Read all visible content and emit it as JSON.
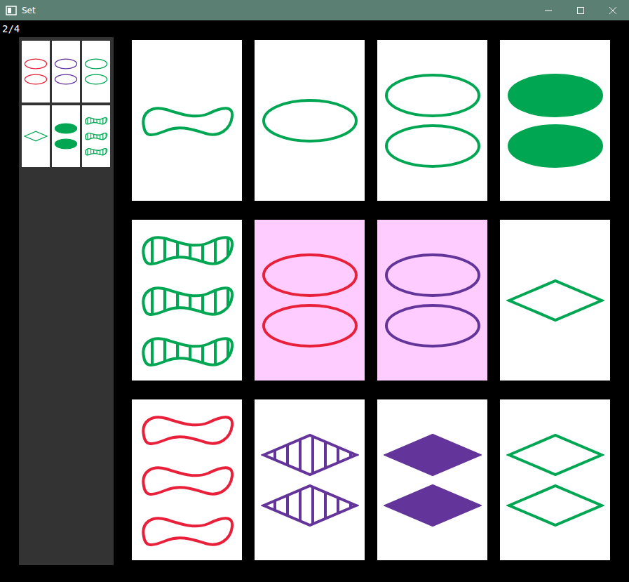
{
  "window": {
    "title": "Set"
  },
  "counter": "2/4",
  "found_sets": [
    [
      {
        "count": 2,
        "kind": "oval",
        "fill": "empty",
        "color": "#e8203a"
      },
      {
        "count": 2,
        "kind": "oval",
        "fill": "empty",
        "color": "#63359a"
      },
      {
        "count": 2,
        "kind": "oval",
        "fill": "empty",
        "color": "#00a651"
      }
    ],
    [
      {
        "count": 1,
        "kind": "diamond",
        "fill": "empty",
        "color": "#00a651"
      },
      {
        "count": 2,
        "kind": "oval",
        "fill": "solid",
        "color": "#00a651"
      },
      {
        "count": 3,
        "kind": "squiggle",
        "fill": "striped",
        "color": "#00a651"
      }
    ]
  ],
  "board": [
    {
      "count": 1,
      "kind": "squiggle",
      "fill": "empty",
      "color": "#00a651",
      "selected": false
    },
    {
      "count": 1,
      "kind": "oval",
      "fill": "empty",
      "color": "#00a651",
      "selected": false
    },
    {
      "count": 2,
      "kind": "oval",
      "fill": "empty",
      "color": "#00a651",
      "selected": false
    },
    {
      "count": 2,
      "kind": "oval",
      "fill": "solid",
      "color": "#00a651",
      "selected": false
    },
    {
      "count": 3,
      "kind": "squiggle",
      "fill": "striped",
      "color": "#00a651",
      "selected": false
    },
    {
      "count": 2,
      "kind": "oval",
      "fill": "empty",
      "color": "#e8203a",
      "selected": true
    },
    {
      "count": 2,
      "kind": "oval",
      "fill": "empty",
      "color": "#63359a",
      "selected": true
    },
    {
      "count": 1,
      "kind": "diamond",
      "fill": "empty",
      "color": "#00a651",
      "selected": false
    },
    {
      "count": 3,
      "kind": "squiggle",
      "fill": "empty",
      "color": "#e8203a",
      "selected": false
    },
    {
      "count": 2,
      "kind": "diamond",
      "fill": "striped",
      "color": "#63359a",
      "selected": false
    },
    {
      "count": 2,
      "kind": "diamond",
      "fill": "solid",
      "color": "#63359a",
      "selected": false
    },
    {
      "count": 2,
      "kind": "diamond",
      "fill": "empty",
      "color": "#00a651",
      "selected": false
    }
  ]
}
